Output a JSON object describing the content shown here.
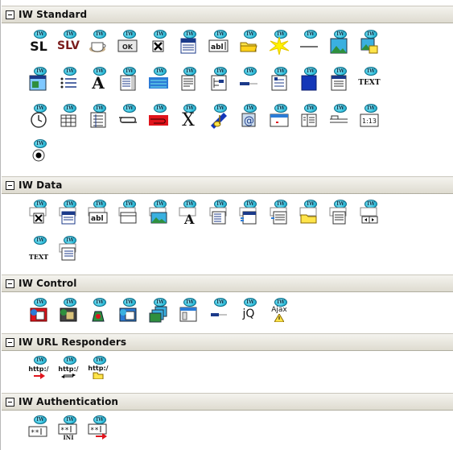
{
  "categories": [
    {
      "title": "IW Standard"
    },
    {
      "title": "IW Data"
    },
    {
      "title": "IW Control"
    },
    {
      "title": "IW URL Responders"
    },
    {
      "title": "IW Authentication"
    }
  ],
  "badge_text": "IW",
  "glyph_text": {
    "sl": "SL",
    "slv": "SLV",
    "ok": "OK",
    "abl": "abl",
    "a": "A",
    "text": "TEXT",
    "x": "X",
    "jq": "jQ",
    "ajax": "Ajax",
    "http": "http:/",
    "ini": "INI",
    "stars": "**",
    "grid": "1:13"
  },
  "colors": {
    "header_bg": "#dedbd0",
    "badge": "#34c2de",
    "red": "#e0141c",
    "blue": "#1437b8",
    "yellow": "#ffe44a",
    "green": "#2f8f3e"
  }
}
